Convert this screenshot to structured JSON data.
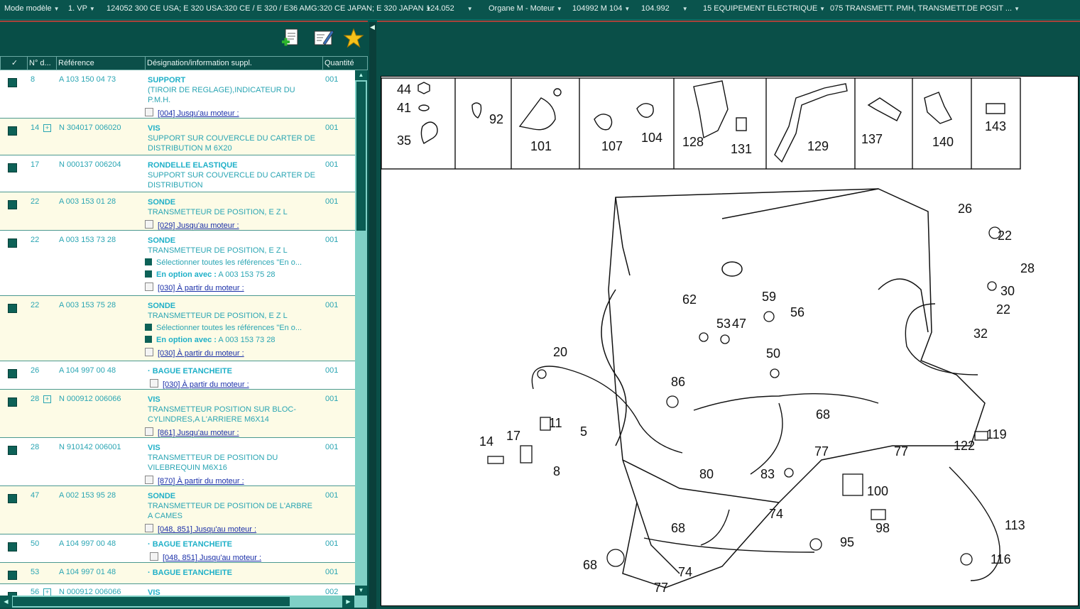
{
  "breadcrumb": [
    {
      "label": "Mode modèle",
      "dropdown": true
    },
    {
      "label": "1. VP",
      "dropdown": true
    },
    {
      "label": "124052 300 CE USA; E 320 USA:320 CE / E 320 / E36 AMG:320 CE JAPAN; E 320 JAPAN",
      "dropdown": true
    },
    {
      "label": "124.052",
      "dropdown": true
    },
    {
      "label": "Organe M - Moteur",
      "dropdown": true
    },
    {
      "label": "104992 M 104",
      "dropdown": true
    },
    {
      "label": "104.992",
      "dropdown": true
    },
    {
      "label": "15 EQUIPEMENT ELECTRIQUE",
      "dropdown": true
    },
    {
      "label": "075 TRANSMETT. PMH, TRANSMETT.DE POSIT ...",
      "dropdown": true
    }
  ],
  "toolbar": {
    "icons": [
      "add-document-icon",
      "edit-list-icon",
      "favorite-star-icon"
    ]
  },
  "table": {
    "headers": {
      "check": "✓",
      "num": "N° d...",
      "ref": "Référence",
      "designation": "Désignation/information suppl.",
      "qty": "Quantité"
    },
    "select_all_text": "Sélectionner toutes les références \"En o...",
    "option_label": "En option avec :",
    "rows": [
      {
        "num": "8",
        "plus": false,
        "ref": "A 103 150 04 73",
        "name": "SUPPORT",
        "desc": "(TIROIR DE REGLAGE),INDICATEUR DU P.M.H.",
        "qty": "001",
        "note": "[004] Jusqu'au moteur :"
      },
      {
        "num": "14",
        "plus": true,
        "ref": "N 304017 006020",
        "name": "VIS",
        "desc": "SUPPORT SUR COUVERCLE DU CARTER DE DISTRIBUTION M 6X20",
        "qty": "001"
      },
      {
        "num": "17",
        "plus": false,
        "ref": "N 000137 006204",
        "name": "RONDELLE ELASTIQUE",
        "desc": "SUPPORT SUR COUVERCLE DU CARTER DE DISTRIBUTION",
        "qty": "001"
      },
      {
        "num": "22",
        "plus": false,
        "ref": "A 003 153 01 28",
        "name": "SONDE",
        "desc": "TRANSMETTEUR DE POSITION, E Z L",
        "qty": "001",
        "note": "[029] Jusqu'au moteur :"
      },
      {
        "num": "22",
        "plus": false,
        "ref": "A 003 153 73 28",
        "name": "SONDE",
        "desc": "TRANSMETTEUR DE POSITION, E Z L",
        "qty": "001",
        "option_ref": "A 003 153 75 28",
        "note": "[030] À partir du moteur :"
      },
      {
        "num": "22",
        "plus": false,
        "ref": "A 003 153 75 28",
        "name": "SONDE",
        "desc": "TRANSMETTEUR DE POSITION, E Z L",
        "qty": "001",
        "option_ref": "A 003 153 73 28",
        "note": "[030] À partir du moteur :"
      },
      {
        "num": "26",
        "plus": false,
        "ref": "A 104 997 00 48",
        "name": "BAGUE ETANCHEITE",
        "desc": "",
        "qty": "001",
        "note": "[030] À partir du moteur :"
      },
      {
        "num": "28",
        "plus": true,
        "ref": "N 000912 006066",
        "name": "VIS",
        "desc": "TRANSMETTEUR POSITION SUR BLOC-CYLINDRES,A L'ARRIERE M6X14",
        "qty": "001",
        "note": "[861] Jusqu'au moteur :"
      },
      {
        "num": "28",
        "plus": false,
        "ref": "N 910142 006001",
        "name": "VIS",
        "desc": "TRANSMETTEUR DE POSITION DU VILEBREQUIN M6X16",
        "qty": "001",
        "note": "[870] À partir du moteur :"
      },
      {
        "num": "47",
        "plus": false,
        "ref": "A 002 153 95 28",
        "name": "SONDE",
        "desc": "TRANSMETTEUR DE POSITION DE L'ARBRE A CAMES",
        "qty": "001",
        "note": "[048, 851] Jusqu'au moteur :"
      },
      {
        "num": "50",
        "plus": false,
        "ref": "A 104 997 00 48",
        "name": "BAGUE ETANCHEITE",
        "desc": "",
        "qty": "001",
        "note": "[048, 851] Jusqu'au moteur :"
      },
      {
        "num": "53",
        "plus": false,
        "ref": "A 104 997 01 48",
        "name": "BAGUE ETANCHEITE",
        "desc": "",
        "qty": "001"
      },
      {
        "num": "56",
        "plus": true,
        "ref": "N 000912 006066",
        "name": "VIS",
        "desc": "",
        "qty": "002"
      }
    ]
  },
  "drawing": {
    "parts_strip": [
      [
        "44",
        "41",
        "35"
      ],
      [
        "92"
      ],
      [
        "101"
      ],
      [
        "107",
        "104"
      ],
      [
        "128",
        "131"
      ],
      [
        "129"
      ],
      [
        "137"
      ],
      [
        "140"
      ],
      [
        "143"
      ]
    ],
    "callouts": [
      "26",
      "22",
      "28",
      "30",
      "22",
      "32",
      "62",
      "59",
      "56",
      "53",
      "47",
      "50",
      "20",
      "86",
      "68",
      "5",
      "11",
      "14",
      "17",
      "8",
      "80",
      "83",
      "77",
      "77",
      "122",
      "119",
      "100",
      "98",
      "95",
      "74",
      "68",
      "113",
      "116",
      "68",
      "74",
      "77"
    ]
  }
}
